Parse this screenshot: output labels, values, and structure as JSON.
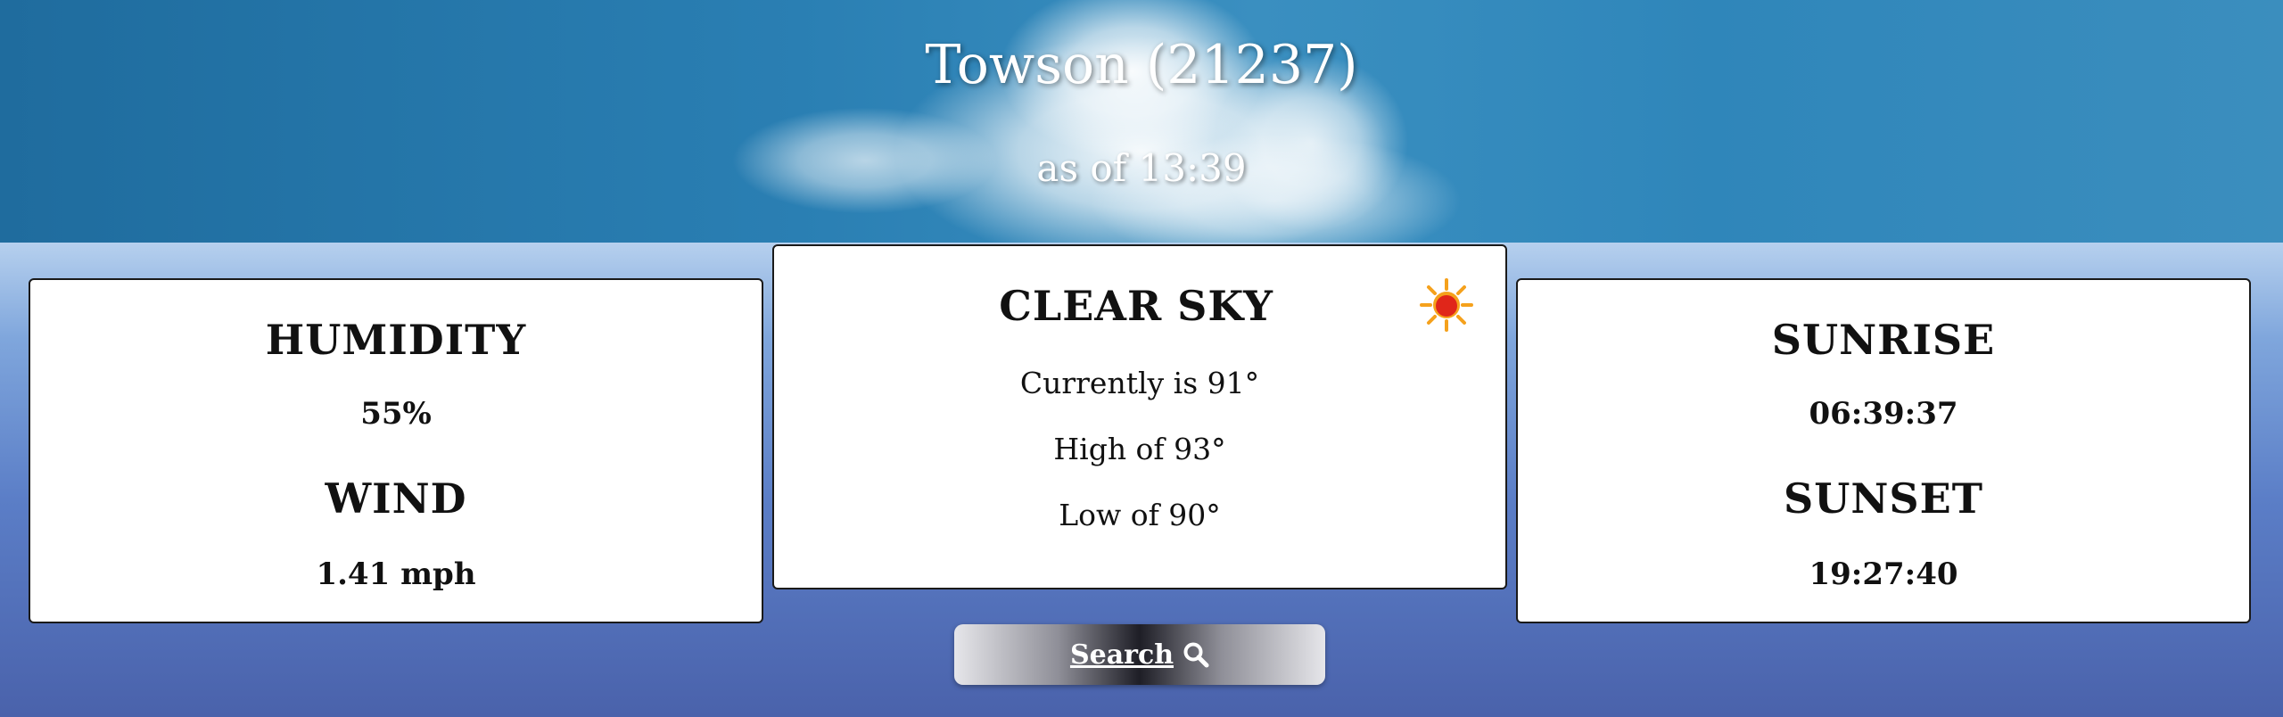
{
  "header": {
    "location": "Towson (21237)",
    "updated": "as of 13:39"
  },
  "left_card": {
    "humidity_label": "HUMIDITY",
    "humidity_value": "55%",
    "wind_label": "WIND",
    "wind_value": "1.41 mph"
  },
  "center_card": {
    "condition": "CLEAR SKY",
    "condition_icon": "sun-icon",
    "current": "Currently is 91°",
    "high": "High of 93°",
    "low": "Low of 90°"
  },
  "right_card": {
    "sunrise_label": "SUNRISE",
    "sunrise_value": "06:39:37",
    "sunset_label": "SUNSET",
    "sunset_value": "19:27:40"
  },
  "search": {
    "label": "Search",
    "icon": "search-icon"
  },
  "colors": {
    "header_sky": "#2a7fb3",
    "page_gradient_top": "#b6d0ee",
    "page_gradient_bottom": "#4a62ab",
    "sun_core": "#e0261a",
    "sun_rays": "#f5a11c"
  }
}
